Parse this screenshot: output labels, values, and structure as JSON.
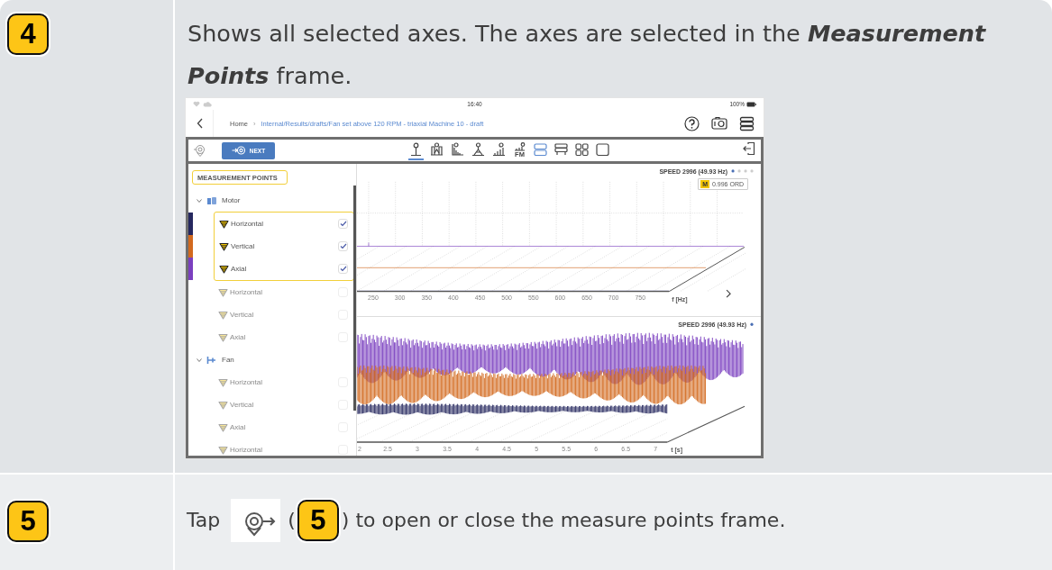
{
  "steps": [
    {
      "kind": "figure",
      "badge": "4",
      "text": "Shows all selected axes. The axes are selected in the **Measurement Points** frame.",
      "app": {
        "status_bar": {
          "time": "16:40",
          "battery": "100%"
        },
        "header": {
          "home": "Home",
          "separator": "›",
          "path": "Internal/Results/drafts/Fan set above 120 RPM - triaxial Machine 10 - draft"
        },
        "toolbar": {
          "next": "NEXT",
          "views": [
            {
              "kind": "pin",
              "selected": true
            },
            {
              "kind": "peaks",
              "selected": false
            },
            {
              "kind": "spectrum",
              "selected": false
            },
            {
              "kind": "waterfall",
              "selected": false
            },
            {
              "kind": "bars",
              "selected": false
            },
            {
              "kind": "fm",
              "label": "FM",
              "selected": false
            },
            {
              "kind": "split",
              "selected": true
            },
            {
              "kind": "rows",
              "selected": false
            },
            {
              "kind": "grid",
              "selected": false
            },
            {
              "kind": "single",
              "selected": false
            }
          ]
        },
        "panel": {
          "title": "MEASUREMENT POINTS",
          "tree": [
            {
              "kind": "machine",
              "name": "Motor",
              "expanded": true,
              "children": [
                {
                  "name": "Horizontal",
                  "checked": true,
                  "color": "#26285f"
                },
                {
                  "name": "Vertical",
                  "checked": true,
                  "color": "#d2691e"
                },
                {
                  "name": "Axial",
                  "checked": true,
                  "color": "#7b3fbf"
                },
                {
                  "name": "Horizontal",
                  "checked": false
                },
                {
                  "name": "Vertical",
                  "checked": false
                },
                {
                  "name": "Axial",
                  "checked": false
                }
              ]
            },
            {
              "kind": "fan",
              "name": "Fan",
              "expanded": true,
              "children": [
                {
                  "name": "Horizontal",
                  "checked": false
                },
                {
                  "name": "Vertical",
                  "checked": false
                },
                {
                  "name": "Axial",
                  "checked": false
                },
                {
                  "name": "Horizontal",
                  "checked": false
                }
              ]
            }
          ]
        },
        "charts": [
          {
            "kind": "spectrum",
            "speed": "SPEED 2996 (49.93 Hz)",
            "pages": [
              {
                "selected": true
              },
              {
                "selected": false
              },
              {
                "selected": false
              },
              {
                "selected": false
              }
            ],
            "marker": {
              "label": "M",
              "value": "0.996 ORD"
            },
            "ticks": [
              "250",
              "300",
              "350",
              "400",
              "450",
              "500",
              "550",
              "600",
              "650",
              "700",
              "750"
            ],
            "axis_label": "f [Hz]"
          },
          {
            "kind": "waveform",
            "speed": "SPEED 2996 (49.93 Hz)",
            "pages": [
              {
                "selected": true
              }
            ],
            "ticks": [
              "2",
              "2.5",
              "3",
              "3.5",
              "4",
              "4.5",
              "5",
              "5.5",
              "6",
              "6.5",
              "7"
            ],
            "axis_label": "t [s]"
          }
        ]
      }
    },
    {
      "kind": "inline",
      "badge": "5",
      "parts": [
        {
          "kind": "text",
          "text": "Tap"
        },
        {
          "kind": "icon"
        },
        {
          "kind": "text",
          "text": "("
        },
        {
          "kind": "badge",
          "text": "5"
        },
        {
          "kind": "text",
          "text": ") to open or close the measure points frame."
        }
      ]
    }
  ]
}
